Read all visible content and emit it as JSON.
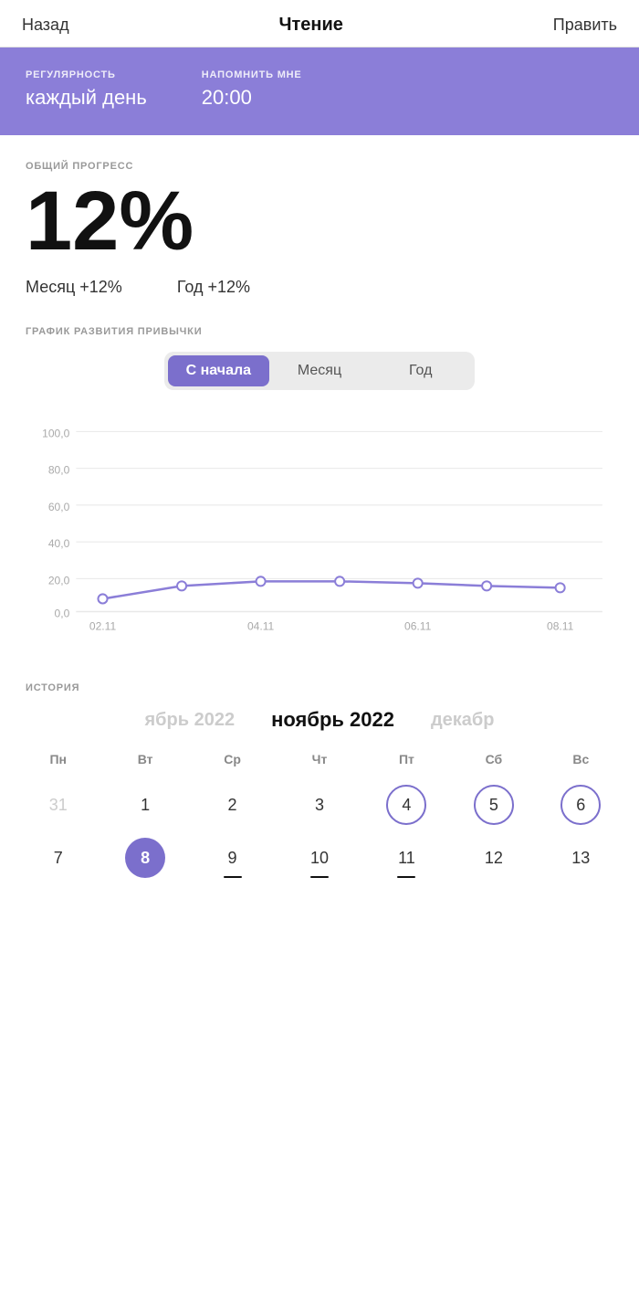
{
  "nav": {
    "back_label": "Назад",
    "title": "Чтение",
    "edit_label": "Править"
  },
  "banner": {
    "regularity_label": "РЕГУЛЯРНОСТЬ",
    "regularity_value": "каждый день",
    "remind_label": "НАПОМНИТЬ МНЕ",
    "remind_value": "20:00"
  },
  "progress": {
    "section_label": "ОБЩИЙ ПРОГРЕСС",
    "percent": "12%",
    "month_stat": "Месяц +12%",
    "year_stat": "Год +12%"
  },
  "chart": {
    "section_label": "ГРАФИК РАЗВИТИЯ ПРИВЫЧКИ",
    "tabs": [
      "С начала",
      "Месяц",
      "Год"
    ],
    "active_tab": 0,
    "x_labels": [
      "02.11",
      "04.11",
      "06.11",
      "08.11"
    ],
    "y_labels": [
      "100,0",
      "80,0",
      "60,0",
      "40,0",
      "20,0",
      "0,0"
    ],
    "data_points": [
      {
        "x": 0.05,
        "y": 0.07
      },
      {
        "x": 0.2,
        "y": 0.14
      },
      {
        "x": 0.35,
        "y": 0.17
      },
      {
        "x": 0.5,
        "y": 0.17
      },
      {
        "x": 0.65,
        "y": 0.16
      },
      {
        "x": 0.78,
        "y": 0.14
      },
      {
        "x": 0.92,
        "y": 0.13
      }
    ]
  },
  "history": {
    "section_label": "ИСТОРИЯ",
    "prev_month": "ябрь 2022",
    "current_month": "ноябрь 2022",
    "next_month": "декабр",
    "weekdays": [
      "Пн",
      "Вт",
      "Ср",
      "Чт",
      "Пт",
      "Сб",
      "Вс"
    ],
    "weeks": [
      [
        {
          "day": "31",
          "style": "dimmed"
        },
        {
          "day": "1",
          "style": "normal"
        },
        {
          "day": "2",
          "style": "normal"
        },
        {
          "day": "3",
          "style": "normal"
        },
        {
          "day": "4",
          "style": "circled"
        },
        {
          "day": "5",
          "style": "circled"
        },
        {
          "day": "6",
          "style": "circled"
        }
      ],
      [
        {
          "day": "7",
          "style": "normal"
        },
        {
          "day": "8",
          "style": "filled"
        },
        {
          "day": "9",
          "style": "underlined"
        },
        {
          "day": "10",
          "style": "underlined"
        },
        {
          "day": "11",
          "style": "underlined"
        },
        {
          "day": "12",
          "style": "normal"
        },
        {
          "day": "13",
          "style": "normal"
        }
      ]
    ]
  }
}
